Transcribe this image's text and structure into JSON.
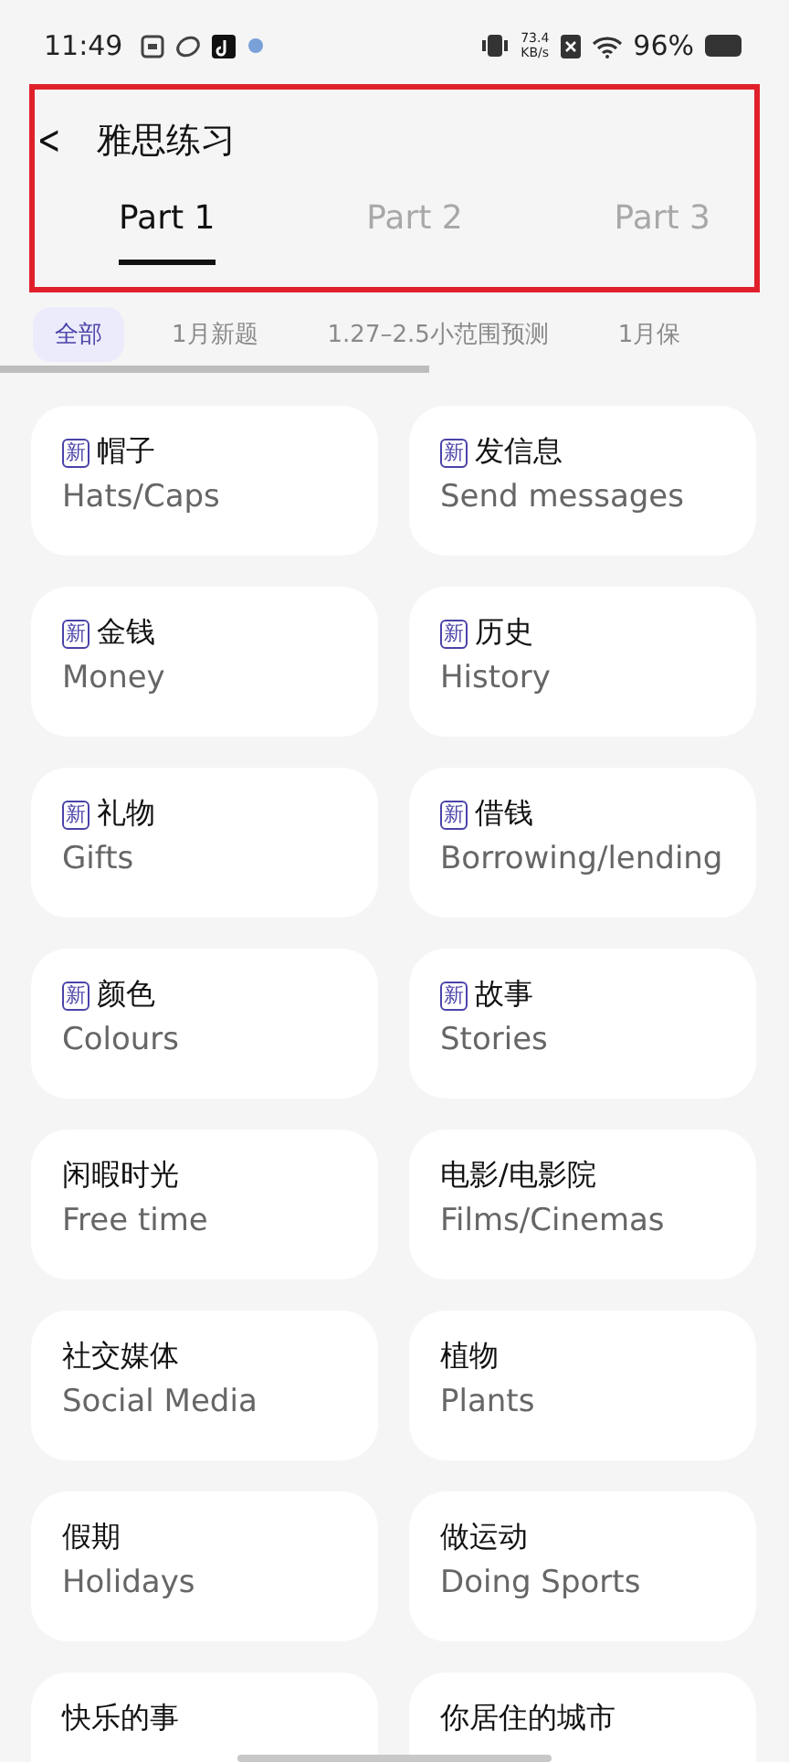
{
  "status_bar": {
    "time": "11:49",
    "net_speed_value": "73.4",
    "net_speed_unit": "KB/s",
    "battery": "96%"
  },
  "header": {
    "back": "<",
    "title": "雅思练习"
  },
  "tabs": [
    {
      "label": "Part 1",
      "selected": true
    },
    {
      "label": "Part 2",
      "selected": false
    },
    {
      "label": "Part 3",
      "selected": false
    }
  ],
  "filters": [
    {
      "label": "全部",
      "selected": true
    },
    {
      "label": "1月新题",
      "selected": false
    },
    {
      "label": "1.27–2.5小范围预测",
      "selected": false
    },
    {
      "label": "1月保",
      "selected": false
    }
  ],
  "topics": [
    {
      "badge": "新",
      "title": "帽子",
      "subtitle": "Hats/Caps"
    },
    {
      "badge": "新",
      "title": "发信息",
      "subtitle": "Send messages"
    },
    {
      "badge": "新",
      "title": "金钱",
      "subtitle": "Money"
    },
    {
      "badge": "新",
      "title": "历史",
      "subtitle": "History"
    },
    {
      "badge": "新",
      "title": "礼物",
      "subtitle": "Gifts"
    },
    {
      "badge": "新",
      "title": "借钱",
      "subtitle": "Borrowing/lending"
    },
    {
      "badge": "新",
      "title": "颜色",
      "subtitle": "Colours"
    },
    {
      "badge": "新",
      "title": "故事",
      "subtitle": "Stories"
    },
    {
      "title": "闲暇时光",
      "subtitle": "Free time"
    },
    {
      "title": "电影/电影院",
      "subtitle": "Films/Cinemas"
    },
    {
      "title": "社交媒体",
      "subtitle": "Social Media"
    },
    {
      "title": "植物",
      "subtitle": "Plants"
    },
    {
      "title": "假期",
      "subtitle": "Holidays"
    },
    {
      "title": "做运动",
      "subtitle": "Doing Sports"
    },
    {
      "title": "快乐的事"
    },
    {
      "title": "你居住的城市"
    }
  ]
}
